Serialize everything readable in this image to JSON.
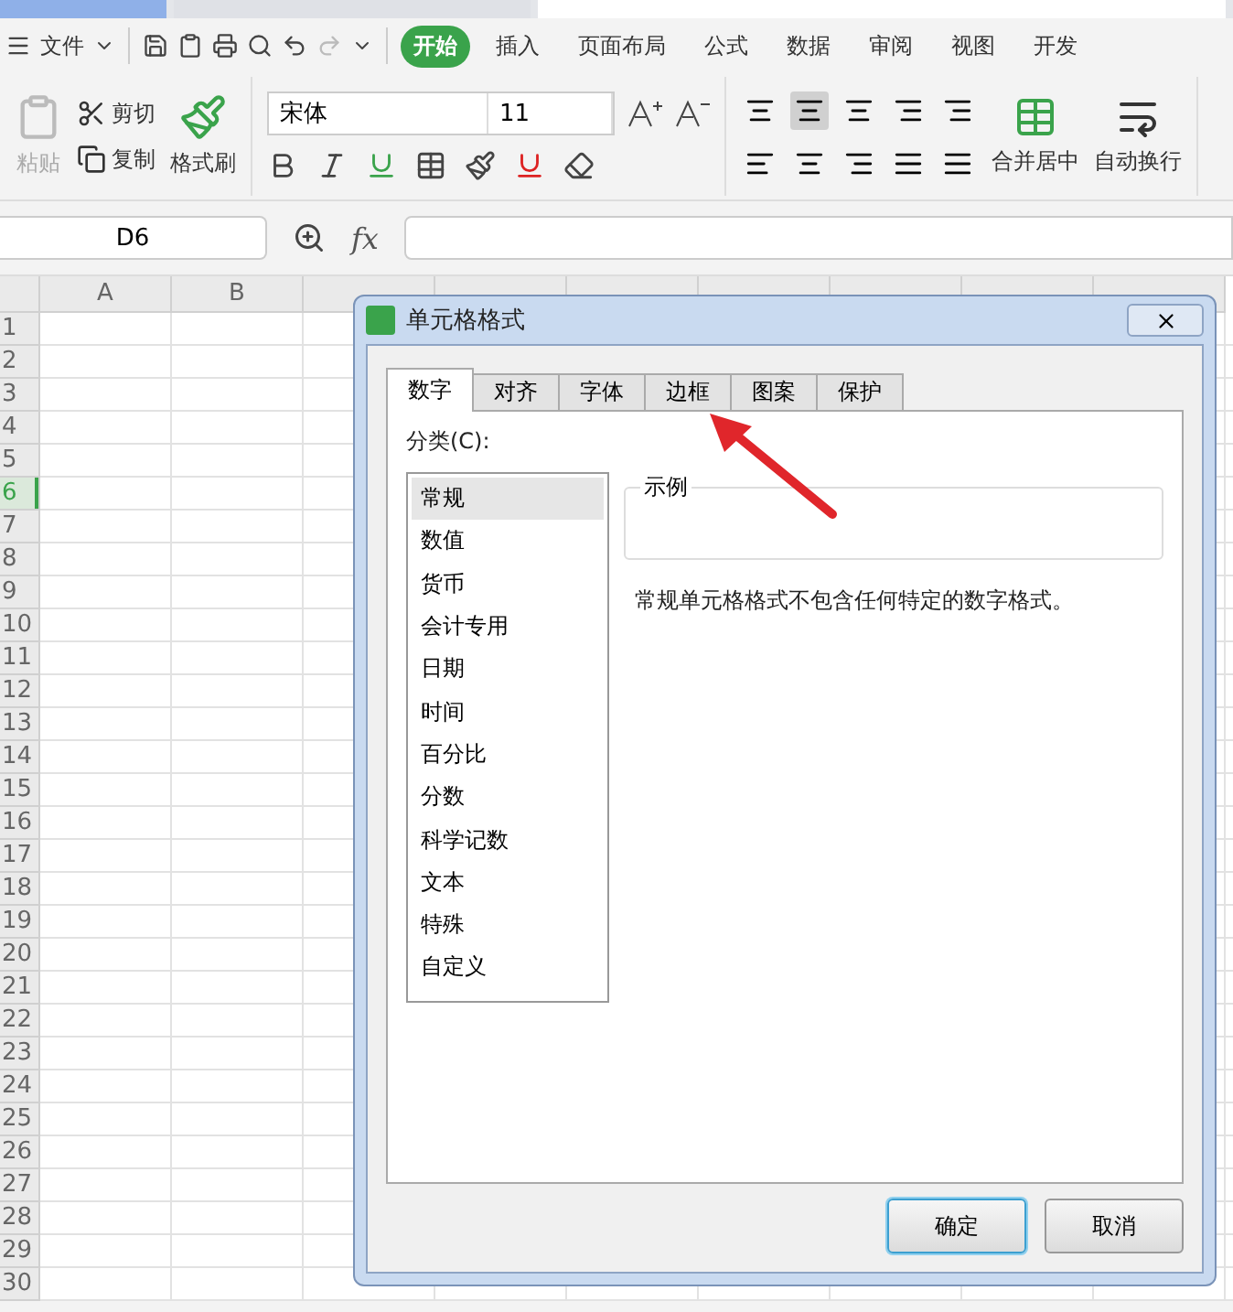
{
  "menu": {
    "file": "文件",
    "tabs": [
      {
        "label": "开始",
        "selected": true
      },
      {
        "label": "插入",
        "selected": false
      },
      {
        "label": "页面布局",
        "selected": false
      },
      {
        "label": "公式",
        "selected": false
      },
      {
        "label": "数据",
        "selected": false
      },
      {
        "label": "审阅",
        "selected": false
      },
      {
        "label": "视图",
        "selected": false
      },
      {
        "label": "开发",
        "selected": false
      }
    ]
  },
  "ribbon": {
    "paste": {
      "label": "粘贴",
      "disabled": true
    },
    "cut": "剪切",
    "copy": "复制",
    "format_painter": "格式刷",
    "font_name": "宋体",
    "font_size": "11",
    "merge": "合并居中",
    "wrap": "自动换行"
  },
  "formula_bar": {
    "name_box": "D6",
    "fx_label": "fx"
  },
  "grid": {
    "columns": [
      {
        "label": "A",
        "selected": false
      },
      {
        "label": "B",
        "selected": false
      }
    ],
    "rows": [
      {
        "label": "1",
        "selected": false
      },
      {
        "label": "2",
        "selected": false
      },
      {
        "label": "3",
        "selected": false
      },
      {
        "label": "4",
        "selected": false
      },
      {
        "label": "5",
        "selected": false
      },
      {
        "label": "6",
        "selected": true
      },
      {
        "label": "7",
        "selected": false
      },
      {
        "label": "8",
        "selected": false
      },
      {
        "label": "9",
        "selected": false
      },
      {
        "label": "10",
        "selected": false
      },
      {
        "label": "11",
        "selected": false
      },
      {
        "label": "12",
        "selected": false
      },
      {
        "label": "13",
        "selected": false
      },
      {
        "label": "14",
        "selected": false
      },
      {
        "label": "15",
        "selected": false
      },
      {
        "label": "16",
        "selected": false
      },
      {
        "label": "17",
        "selected": false
      },
      {
        "label": "18",
        "selected": false
      },
      {
        "label": "19",
        "selected": false
      },
      {
        "label": "20",
        "selected": false
      },
      {
        "label": "21",
        "selected": false
      },
      {
        "label": "22",
        "selected": false
      },
      {
        "label": "23",
        "selected": false
      },
      {
        "label": "24",
        "selected": false
      },
      {
        "label": "25",
        "selected": false
      },
      {
        "label": "26",
        "selected": false
      },
      {
        "label": "27",
        "selected": false
      },
      {
        "label": "28",
        "selected": false
      },
      {
        "label": "29",
        "selected": false
      },
      {
        "label": "30",
        "selected": false
      }
    ]
  },
  "dialog": {
    "title": "单元格格式",
    "tabs": [
      {
        "label": "数字",
        "selected": true
      },
      {
        "label": "对齐",
        "selected": false
      },
      {
        "label": "字体",
        "selected": false
      },
      {
        "label": "边框",
        "selected": false
      },
      {
        "label": "图案",
        "selected": false
      },
      {
        "label": "保护",
        "selected": false
      }
    ],
    "category_label": "分类(C):",
    "categories": [
      {
        "label": "常规",
        "selected": true
      },
      {
        "label": "数值",
        "selected": false
      },
      {
        "label": "货币",
        "selected": false
      },
      {
        "label": "会计专用",
        "selected": false
      },
      {
        "label": "日期",
        "selected": false
      },
      {
        "label": "时间",
        "selected": false
      },
      {
        "label": "百分比",
        "selected": false
      },
      {
        "label": "分数",
        "selected": false
      },
      {
        "label": "科学记数",
        "selected": false
      },
      {
        "label": "文本",
        "selected": false
      },
      {
        "label": "特殊",
        "selected": false
      },
      {
        "label": "自定义",
        "selected": false
      }
    ],
    "sample_label": "示例",
    "description": "常规单元格格式不包含任何特定的数字格式。",
    "buttons": [
      {
        "label": "确定",
        "default": true
      },
      {
        "label": "取消",
        "default": false
      }
    ]
  }
}
